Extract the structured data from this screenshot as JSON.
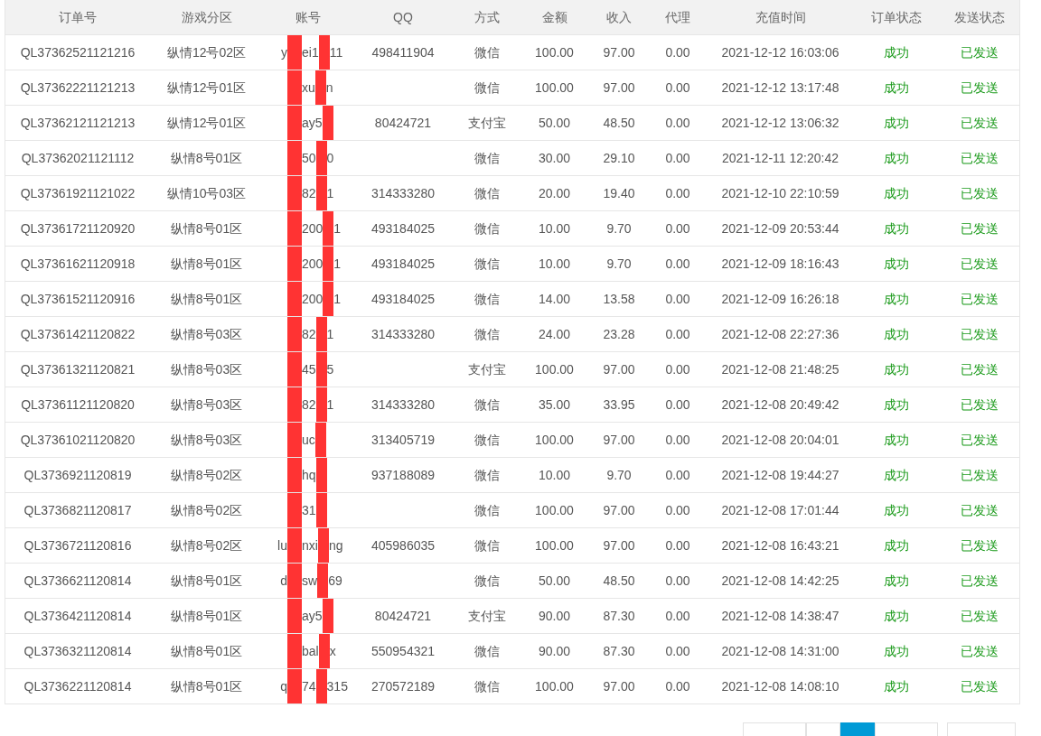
{
  "columns": [
    "订单号",
    "游戏分区",
    "账号",
    "QQ",
    "方式",
    "金额",
    "收入",
    "代理",
    "充值时间",
    "订单状态",
    "发送状态"
  ],
  "rows": [
    {
      "order": "QL37362521121216",
      "zone": "纵情12号02区",
      "account": {
        "before": "y",
        "middle": "ei1",
        "after": "11"
      },
      "qq": "498411904",
      "method": "微信",
      "amount": "100.00",
      "income": "97.00",
      "agent": "0.00",
      "time": "2021-12-12 16:03:06",
      "status": "成功",
      "sent": "已发送"
    },
    {
      "order": "QL37362221121213",
      "zone": "纵情12号01区",
      "account": {
        "middle": "xu",
        "after": "n"
      },
      "method": "微信",
      "amount": "100.00",
      "income": "97.00",
      "agent": "0.00",
      "time": "2021-12-12 13:17:48",
      "status": "成功",
      "sent": "已发送"
    },
    {
      "order": "QL37362121121213",
      "zone": "纵情12号01区",
      "account": {
        "middle": "ay5"
      },
      "qq": "80424721",
      "method": "支付宝",
      "amount": "50.00",
      "income": "48.50",
      "agent": "0.00",
      "time": "2021-12-12 13:06:32",
      "status": "成功",
      "sent": "已发送"
    },
    {
      "order": "QL37362021121112",
      "zone": "纵情8号01区",
      "account": {
        "middle": "50",
        "after": "0"
      },
      "method": "微信",
      "amount": "30.00",
      "income": "29.10",
      "agent": "0.00",
      "time": "2021-12-11 12:20:42",
      "status": "成功",
      "sent": "已发送"
    },
    {
      "order": "QL37361921121022",
      "zone": "纵情10号03区",
      "account": {
        "middle": "82",
        "after": "1"
      },
      "qq": "314333280",
      "method": "微信",
      "amount": "20.00",
      "income": "19.40",
      "agent": "0.00",
      "time": "2021-12-10 22:10:59",
      "status": "成功",
      "sent": "已发送"
    },
    {
      "order": "QL37361721120920",
      "zone": "纵情8号01区",
      "account": {
        "middle": "200",
        "after": "1"
      },
      "qq": "493184025",
      "method": "微信",
      "amount": "10.00",
      "income": "9.70",
      "agent": "0.00",
      "time": "2021-12-09 20:53:44",
      "status": "成功",
      "sent": "已发送"
    },
    {
      "order": "QL37361621120918",
      "zone": "纵情8号01区",
      "account": {
        "middle": "200",
        "after": "1"
      },
      "qq": "493184025",
      "method": "微信",
      "amount": "10.00",
      "income": "9.70",
      "agent": "0.00",
      "time": "2021-12-09 18:16:43",
      "status": "成功",
      "sent": "已发送"
    },
    {
      "order": "QL37361521120916",
      "zone": "纵情8号01区",
      "account": {
        "middle": "200",
        "after": "1"
      },
      "qq": "493184025",
      "method": "微信",
      "amount": "14.00",
      "income": "13.58",
      "agent": "0.00",
      "time": "2021-12-09 16:26:18",
      "status": "成功",
      "sent": "已发送"
    },
    {
      "order": "QL37361421120822",
      "zone": "纵情8号03区",
      "account": {
        "middle": "82",
        "after": "1"
      },
      "qq": "314333280",
      "method": "微信",
      "amount": "24.00",
      "income": "23.28",
      "agent": "0.00",
      "time": "2021-12-08 22:27:36",
      "status": "成功",
      "sent": "已发送"
    },
    {
      "order": "QL37361321120821",
      "zone": "纵情8号03区",
      "account": {
        "middle": "45",
        "after": "5"
      },
      "method": "支付宝",
      "amount": "100.00",
      "income": "97.00",
      "agent": "0.00",
      "time": "2021-12-08 21:48:25",
      "status": "成功",
      "sent": "已发送"
    },
    {
      "order": "QL37361121120820",
      "zone": "纵情8号03区",
      "account": {
        "middle": "82",
        "after": "1"
      },
      "qq": "314333280",
      "method": "微信",
      "amount": "35.00",
      "income": "33.95",
      "agent": "0.00",
      "time": "2021-12-08 20:49:42",
      "status": "成功",
      "sent": "已发送"
    },
    {
      "order": "QL37361021120820",
      "zone": "纵情8号03区",
      "account": {
        "middle": "uc"
      },
      "qq": "313405719",
      "method": "微信",
      "amount": "100.00",
      "income": "97.00",
      "agent": "0.00",
      "time": "2021-12-08 20:04:01",
      "status": "成功",
      "sent": "已发送"
    },
    {
      "order": "QL3736921120819",
      "zone": "纵情8号02区",
      "account": {
        "middle": "hq"
      },
      "qq": "937188089",
      "method": "微信",
      "amount": "10.00",
      "income": "9.70",
      "agent": "0.00",
      "time": "2021-12-08 19:44:27",
      "status": "成功",
      "sent": "已发送"
    },
    {
      "order": "QL3736821120817",
      "zone": "纵情8号02区",
      "account": {
        "middle": "31"
      },
      "method": "微信",
      "amount": "100.00",
      "income": "97.00",
      "agent": "0.00",
      "time": "2021-12-08 17:01:44",
      "status": "成功",
      "sent": "已发送"
    },
    {
      "order": "QL3736721120816",
      "zone": "纵情8号02区",
      "account": {
        "before": "lu",
        "middle": "nxi",
        "after": "ng"
      },
      "qq": "405986035",
      "method": "微信",
      "amount": "100.00",
      "income": "97.00",
      "agent": "0.00",
      "time": "2021-12-08 16:43:21",
      "status": "成功",
      "sent": "已发送"
    },
    {
      "order": "QL3736621120814",
      "zone": "纵情8号01区",
      "account": {
        "before": "d",
        "middle": "sw",
        "after": "69"
      },
      "method": "微信",
      "amount": "50.00",
      "income": "48.50",
      "agent": "0.00",
      "time": "2021-12-08 14:42:25",
      "status": "成功",
      "sent": "已发送"
    },
    {
      "order": "QL3736421120814",
      "zone": "纵情8号01区",
      "account": {
        "middle": "ay5"
      },
      "qq": "80424721",
      "method": "支付宝",
      "amount": "90.00",
      "income": "87.30",
      "agent": "0.00",
      "time": "2021-12-08 14:38:47",
      "status": "成功",
      "sent": "已发送"
    },
    {
      "order": "QL3736321120814",
      "zone": "纵情8号01区",
      "account": {
        "middle": "bal",
        "after": "x"
      },
      "qq": "550954321",
      "method": "微信",
      "amount": "90.00",
      "income": "87.30",
      "agent": "0.00",
      "time": "2021-12-08 14:31:00",
      "status": "成功",
      "sent": "已发送"
    },
    {
      "order": "QL3736221120814",
      "zone": "纵情8号01区",
      "account": {
        "before": "q",
        "middle": "74",
        "after": "315"
      },
      "qq": "270572189",
      "method": "微信",
      "amount": "100.00",
      "income": "97.00",
      "agent": "0.00",
      "time": "2021-12-08 14:08:10",
      "status": "成功",
      "sent": "已发送"
    }
  ],
  "pagination": {
    "pages": [
      {
        "selected": false
      },
      {
        "selected": true
      }
    ]
  }
}
